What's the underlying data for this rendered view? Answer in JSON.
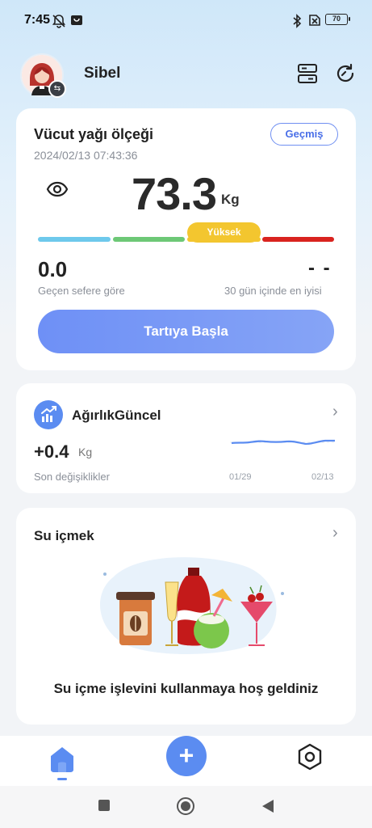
{
  "status_bar": {
    "time": "7:45",
    "battery": "70",
    "icons": [
      "notifications-off-icon",
      "store-icon",
      "bluetooth-icon",
      "no-sim-icon",
      "battery-icon"
    ]
  },
  "header": {
    "username": "Sibel",
    "icons": [
      "avatar",
      "switch-user-icon",
      "devices-icon",
      "refresh-icon"
    ]
  },
  "body_fat_card": {
    "title": "Vücut yağı ölçeği",
    "date": "2024/02/13 07:43:36",
    "history_label": "Geçmiş",
    "weight_value": "73.3",
    "weight_unit": "Kg",
    "status_badge": "Yüksek",
    "scale_colors": [
      "#6ec9ec",
      "#6dc876",
      "#f3c62f",
      "#d9231f"
    ],
    "change_value": "0.0",
    "change_label": "Geçen sefere göre",
    "best_value": "- -",
    "best_label": "30 gün içinde en iyisi",
    "start_button": "Tartıya Başla"
  },
  "weight_card": {
    "title": "AğırlıkGüncel",
    "change_value": "+0.4",
    "change_unit": "Kg",
    "change_label": "Son değişiklikler",
    "chart_start": "01/29",
    "chart_end": "02/13"
  },
  "water_card": {
    "title": "Su içmek",
    "welcome_text": "Su içme işlevini kullanmaya hoş geldiniz"
  },
  "bottom_nav": {
    "items": [
      "home-icon",
      "add-icon",
      "settings-icon"
    ],
    "add_symbol": "+"
  },
  "colors": {
    "accent": "#5b8cf1",
    "badge": "#f3c62f"
  }
}
